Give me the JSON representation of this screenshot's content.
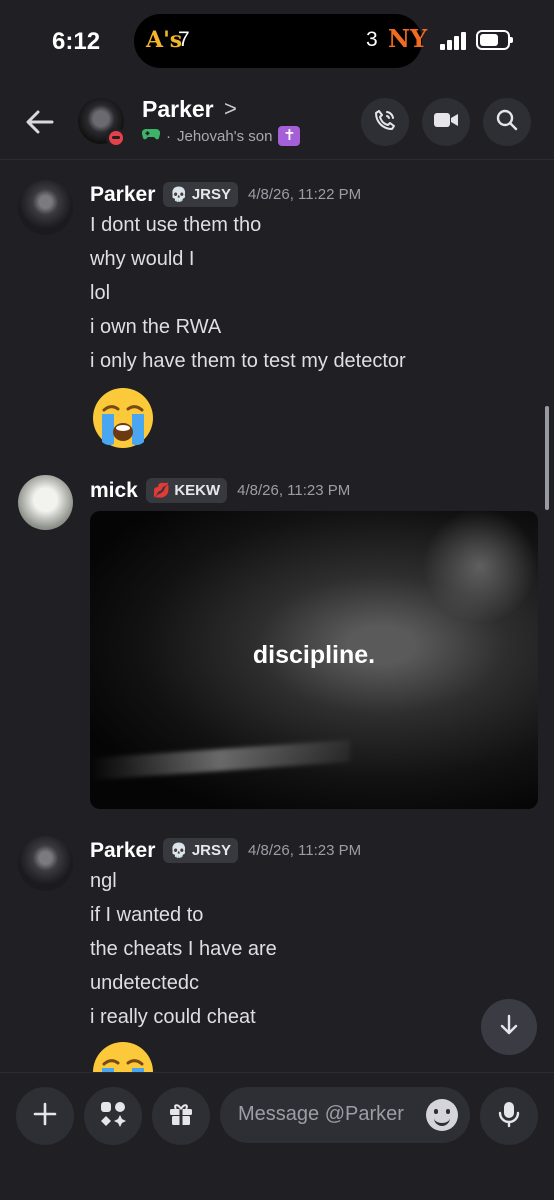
{
  "status_bar": {
    "time": "6:12",
    "live_activity": {
      "team_a_logo": "A's",
      "team_a_score": "7",
      "team_b_score": "3",
      "team_b_logo": "NY"
    }
  },
  "header": {
    "name": "Parker",
    "chevron": ">",
    "activity": "Jehovah's son",
    "activity_badge": "✝"
  },
  "messages": [
    {
      "author": "Parker",
      "tag_icon": "skull",
      "tag": "JRSY",
      "timestamp": "4/8/26, 11:22 PM",
      "lines": [
        "I dont use them tho",
        "why would I",
        "lol",
        "i own the RWA",
        "i only have them to test my detector"
      ],
      "emoji": "loudly-crying-face"
    },
    {
      "author": "mick",
      "tag_icon": "lips",
      "tag": "KEKW",
      "timestamp": "4/8/26, 11:23 PM",
      "attachment_caption": "discipline."
    },
    {
      "author": "Parker",
      "tag_icon": "skull",
      "tag": "JRSY",
      "timestamp": "4/8/26, 11:23 PM",
      "lines": [
        "ngl",
        "if I wanted to",
        "the cheats I have are",
        "undetectedc",
        "i really could cheat"
      ],
      "emoji": "loudly-crying-face"
    }
  ],
  "composer": {
    "placeholder": "Message @Parker"
  },
  "colors": {
    "background": "#1f1f24",
    "surface": "#2e2e35",
    "dnd": "#e3424a",
    "game": "#3fb26a",
    "badge": "#a560d8"
  }
}
